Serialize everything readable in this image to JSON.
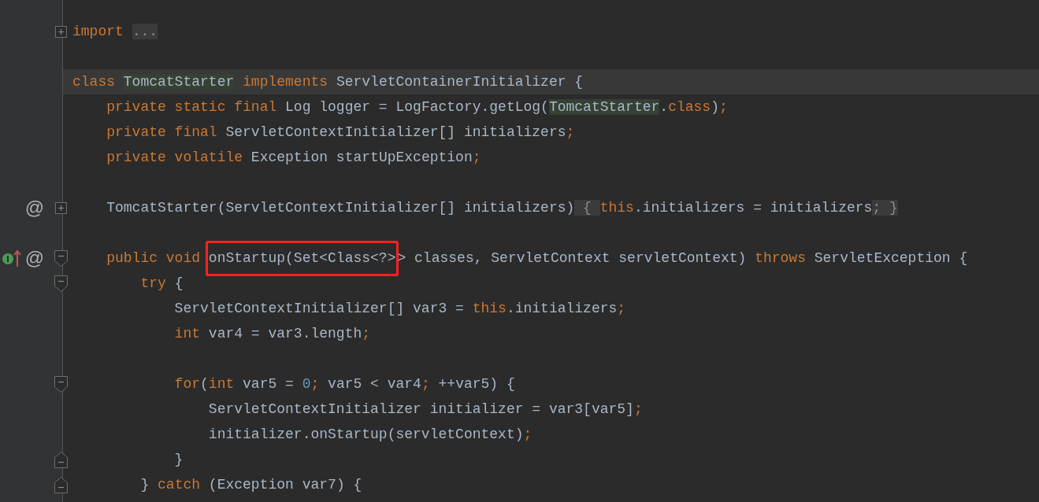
{
  "editor": {
    "lines": [
      {
        "current": false,
        "fold_marker": {
          "kind": "expand"
        },
        "segments": [
          {
            "boxed": false,
            "tokens": [
              {
                "t": "import ",
                "kind": "kw"
              },
              {
                "t": "...",
                "kind": "folded"
              }
            ]
          }
        ]
      },
      {
        "current": false
      },
      {
        "current": true,
        "segments": [
          {
            "boxed": false,
            "tokens": [
              {
                "t": "class ",
                "kind": "kw"
              },
              {
                "t": "TomcatStarter",
                "kind": "usage"
              },
              {
                "t": " implements",
                "kind": "kw"
              },
              {
                "t": " ServletContainerInitializer {",
                "kind": "id"
              }
            ]
          }
        ]
      },
      {
        "current": false,
        "segments": [
          {
            "boxed": false,
            "tokens": [
              {
                "t": "    private static final",
                "kind": "kw"
              },
              {
                "t": " Log logger = LogFactory.getLog(",
                "kind": "id"
              },
              {
                "t": "TomcatStarter",
                "kind": "usage"
              },
              {
                "t": ".",
                "kind": "id"
              },
              {
                "t": "class",
                "kind": "kw"
              },
              {
                "t": ")",
                "kind": "id"
              },
              {
                "t": ";",
                "kind": "kw"
              }
            ]
          }
        ]
      },
      {
        "current": false,
        "segments": [
          {
            "boxed": false,
            "tokens": [
              {
                "t": "    private final",
                "kind": "kw"
              },
              {
                "t": " ServletContextInitializer[] initializers",
                "kind": "id"
              },
              {
                "t": ";",
                "kind": "kw"
              }
            ]
          }
        ]
      },
      {
        "current": false,
        "segments": [
          {
            "boxed": false,
            "tokens": [
              {
                "t": "    private volatile",
                "kind": "kw"
              },
              {
                "t": " Exception startUpException",
                "kind": "id"
              },
              {
                "t": ";",
                "kind": "kw"
              }
            ]
          }
        ]
      },
      {
        "current": false
      },
      {
        "current": false,
        "mark": "@",
        "fold_marker": {
          "kind": "expand"
        },
        "segments": [
          {
            "boxed": false,
            "tokens": [
              {
                "t": "    TomcatStarter(ServletContextInitializer[] initializers)",
                "kind": "id"
              },
              {
                "t": " { ",
                "kind": "folded"
              },
              {
                "t": "this",
                "kind": "kw"
              },
              {
                "t": ".initializers = initializers",
                "kind": "id"
              },
              {
                "t": "; }",
                "kind": "folded"
              }
            ]
          }
        ]
      },
      {
        "current": false
      },
      {
        "current": false,
        "mark": "@",
        "gutter_icons": [
          {
            "kind": "implements"
          }
        ],
        "fold_marker": {
          "kind": "collapse"
        },
        "segments": [
          {
            "boxed": false,
            "tokens": [
              {
                "t": "    public void ",
                "kind": "kw"
              }
            ]
          },
          {
            "boxed": true,
            "tokens": [
              {
                "t": "onStartup(Set<Class<?>",
                "kind": "id"
              }
            ]
          },
          {
            "boxed": false,
            "tokens": [
              {
                "t": "> classes, ServletContext servletContext) ",
                "kind": "id"
              },
              {
                "t": "throws",
                "kind": "kw"
              },
              {
                "t": " ServletException {",
                "kind": "id"
              }
            ]
          }
        ]
      },
      {
        "current": false,
        "fold_marker": {
          "kind": "collapse"
        },
        "segments": [
          {
            "boxed": false,
            "tokens": [
              {
                "t": "        try",
                "kind": "kw"
              },
              {
                "t": " {",
                "kind": "id"
              }
            ]
          }
        ]
      },
      {
        "current": false,
        "segments": [
          {
            "boxed": false,
            "tokens": [
              {
                "t": "            ServletContextInitializer[] var3 = ",
                "kind": "id"
              },
              {
                "t": "this",
                "kind": "kw"
              },
              {
                "t": ".initializers",
                "kind": "id"
              },
              {
                "t": ";",
                "kind": "kw"
              }
            ]
          }
        ]
      },
      {
        "current": false,
        "segments": [
          {
            "boxed": false,
            "tokens": [
              {
                "t": "            int",
                "kind": "kw"
              },
              {
                "t": " var4 = var3.length",
                "kind": "id"
              },
              {
                "t": ";",
                "kind": "kw"
              }
            ]
          }
        ]
      },
      {
        "current": false
      },
      {
        "current": false,
        "fold_marker": {
          "kind": "collapse"
        },
        "segments": [
          {
            "boxed": false,
            "tokens": [
              {
                "t": "            for",
                "kind": "kw"
              },
              {
                "t": "(",
                "kind": "id"
              },
              {
                "t": "int",
                "kind": "kw"
              },
              {
                "t": " var5 = ",
                "kind": "id"
              },
              {
                "t": "0",
                "kind": "num"
              },
              {
                "t": ";",
                "kind": "kw"
              },
              {
                "t": " var5 < var4",
                "kind": "id"
              },
              {
                "t": ";",
                "kind": "kw"
              },
              {
                "t": " ++var5) {",
                "kind": "id"
              }
            ]
          }
        ]
      },
      {
        "current": false,
        "segments": [
          {
            "boxed": false,
            "tokens": [
              {
                "t": "                ServletContextInitializer initializer = var3[var5]",
                "kind": "id"
              },
              {
                "t": ";",
                "kind": "kw"
              }
            ]
          }
        ]
      },
      {
        "current": false,
        "segments": [
          {
            "boxed": false,
            "tokens": [
              {
                "t": "                initializer.onStartup(servletContext)",
                "kind": "id"
              },
              {
                "t": ";",
                "kind": "kw"
              }
            ]
          }
        ]
      },
      {
        "current": false,
        "fold_marker": {
          "kind": "end"
        },
        "segments": [
          {
            "boxed": false,
            "tokens": [
              {
                "t": "            }",
                "kind": "id"
              }
            ]
          }
        ]
      },
      {
        "current": false,
        "fold_marker": {
          "kind": "end"
        },
        "segments": [
          {
            "boxed": false,
            "tokens": [
              {
                "t": "        } ",
                "kind": "id"
              },
              {
                "t": "catch",
                "kind": "kw"
              },
              {
                "t": " (Exception var7) {",
                "kind": "id"
              }
            ]
          }
        ]
      }
    ]
  }
}
